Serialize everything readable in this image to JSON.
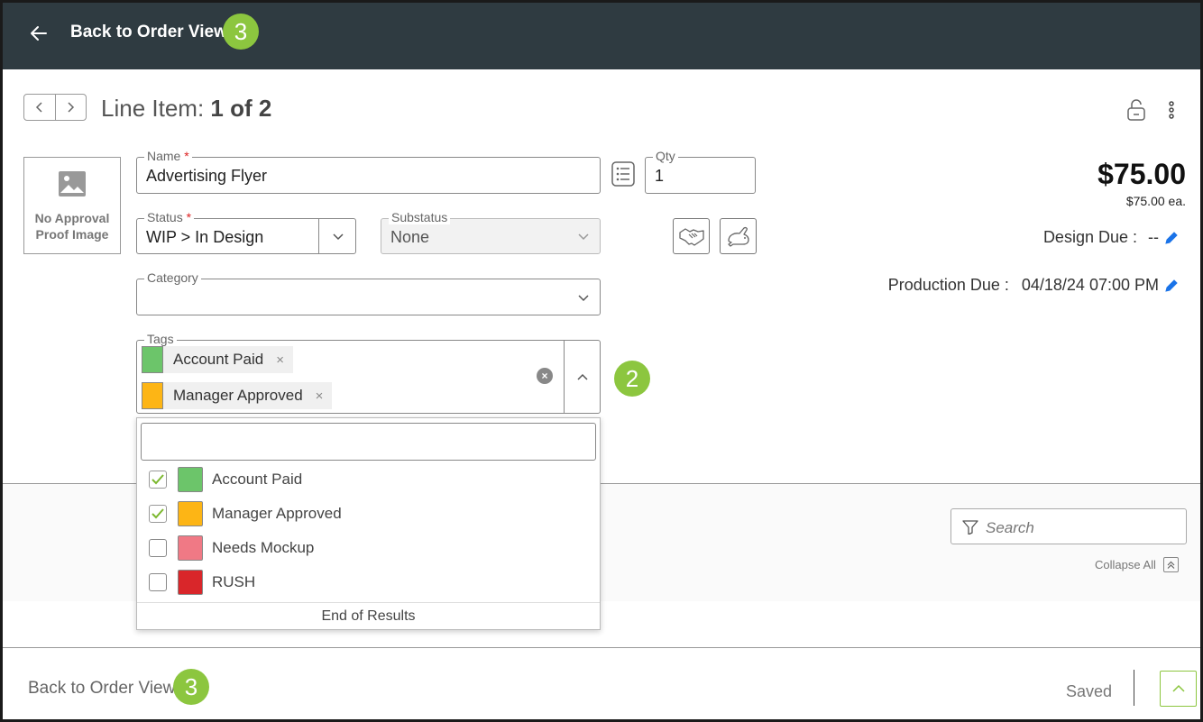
{
  "header": {
    "back_label": "Back to Order View",
    "badge": "3"
  },
  "line_item": {
    "title_prefix": "Line Item:",
    "title_count": "1 of 2"
  },
  "proof": {
    "text": "No Approval Proof Image"
  },
  "form": {
    "name_label": "Name",
    "name_value": "Advertising Flyer",
    "qty_label": "Qty",
    "qty_value": "1",
    "status_label": "Status",
    "status_value": "WIP > In Design",
    "substatus_label": "Substatus",
    "substatus_value": "None",
    "category_label": "Category",
    "category_value": "",
    "tags_label": "Tags",
    "required_mark": "*"
  },
  "tags": [
    {
      "label": "Account Paid",
      "color": "#6cc56a",
      "remove": "×"
    },
    {
      "label": "Manager Approved",
      "color": "#fdb515",
      "remove": "×"
    }
  ],
  "tags_badge": "2",
  "pricing": {
    "total": "$75.00",
    "each": "$75.00 ea.",
    "design_due_label": "Design Due :",
    "design_due_value": "--",
    "production_due_label": "Production Due :",
    "production_due_value": "04/18/24 07:00 PM"
  },
  "dropdown": {
    "search_value": "",
    "options": [
      {
        "label": "Account Paid",
        "color": "#6cc56a",
        "checked": true
      },
      {
        "label": "Manager Approved",
        "color": "#fdb515",
        "checked": true
      },
      {
        "label": "Needs Mockup",
        "color": "#f07985",
        "checked": false
      },
      {
        "label": "RUSH",
        "color": "#d9262a",
        "checked": false
      }
    ],
    "end_text": "End of Results"
  },
  "toolbar": {
    "search_placeholder": "Search",
    "collapse_all": "Collapse All"
  },
  "footer": {
    "back_label": "Back to Order View",
    "badge": "3",
    "saved": "Saved"
  },
  "colors": {
    "topbar": "#2f3b41",
    "accent_green": "#8cc63f",
    "pencil_blue": "#1a73e8"
  }
}
